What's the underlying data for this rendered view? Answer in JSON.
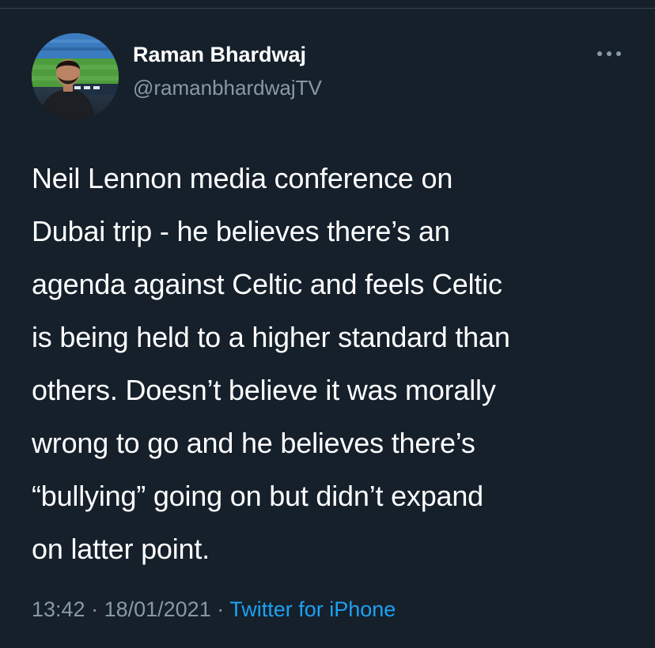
{
  "tweet": {
    "author_name": "Raman Bhardwaj",
    "author_handle": "@ramanbhardwajTV",
    "more_icon": "more-horizontal-icon",
    "text": "Neil Lennon media conference on\nDubai trip - he believes there’s an\nagenda against Celtic and feels Celtic\nis being held to a higher standard than\nothers. Doesn’t believe it was morally\nwrong to go and he believes there’s\n“bullying” going on but didn’t expand\non latter point.",
    "time": "13:42",
    "separator": " · ",
    "date": "18/01/2021",
    "source": "Twitter for iPhone"
  },
  "colors": {
    "background": "#15202b",
    "text_primary": "#ffffff",
    "text_secondary": "#8899a6",
    "link": "#1da1f2",
    "divider": "#38444d"
  }
}
